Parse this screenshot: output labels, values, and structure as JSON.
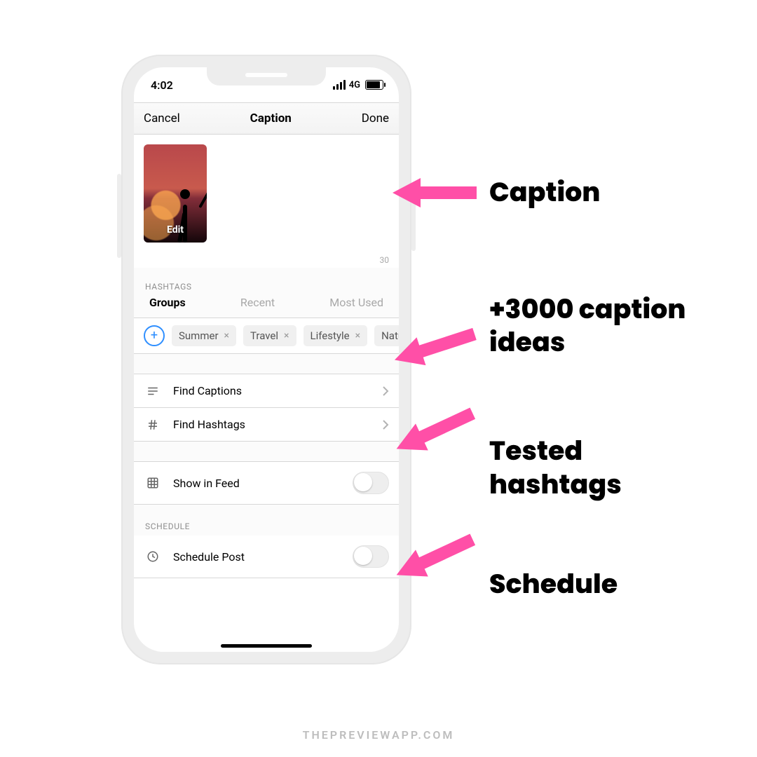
{
  "status": {
    "time": "4:02",
    "network": "4G"
  },
  "nav": {
    "left": "Cancel",
    "title": "Caption",
    "right": "Done"
  },
  "thumb": {
    "edit": "Edit"
  },
  "caption": {
    "count": "30"
  },
  "hashtags": {
    "header": "HASHTAGS",
    "tabs": {
      "groups": "Groups",
      "recent": "Recent",
      "most_used": "Most Used"
    },
    "chips": [
      "Summer",
      "Travel",
      "Lifestyle",
      "Nature"
    ]
  },
  "rows": {
    "find_captions": "Find Captions",
    "find_hashtags": "Find Hashtags",
    "show_in_feed": "Show in Feed",
    "schedule_header": "SCHEDULE",
    "schedule_post": "Schedule Post"
  },
  "annotations": {
    "a1": "Caption",
    "a2": "+3000 caption ideas",
    "a3": "Tested hashtags",
    "a4": "Schedule"
  },
  "footer": "THEPREVIEWAPP.COM",
  "colors": {
    "pink": "#ff4fa7"
  }
}
